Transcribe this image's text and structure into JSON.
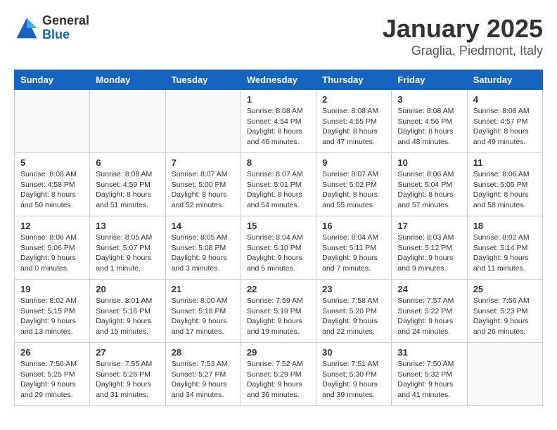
{
  "logo": {
    "general": "General",
    "blue": "Blue"
  },
  "title": "January 2025",
  "location": "Graglia, Piedmont, Italy",
  "weekdays": [
    "Sunday",
    "Monday",
    "Tuesday",
    "Wednesday",
    "Thursday",
    "Friday",
    "Saturday"
  ],
  "weeks": [
    [
      {
        "day": "",
        "info": ""
      },
      {
        "day": "",
        "info": ""
      },
      {
        "day": "",
        "info": ""
      },
      {
        "day": "1",
        "info": "Sunrise: 8:08 AM\nSunset: 4:54 PM\nDaylight: 8 hours and 46 minutes."
      },
      {
        "day": "2",
        "info": "Sunrise: 8:08 AM\nSunset: 4:55 PM\nDaylight: 8 hours and 47 minutes."
      },
      {
        "day": "3",
        "info": "Sunrise: 8:08 AM\nSunset: 4:56 PM\nDaylight: 8 hours and 48 minutes."
      },
      {
        "day": "4",
        "info": "Sunrise: 8:08 AM\nSunset: 4:57 PM\nDaylight: 8 hours and 49 minutes."
      }
    ],
    [
      {
        "day": "5",
        "info": "Sunrise: 8:08 AM\nSunset: 4:58 PM\nDaylight: 8 hours and 50 minutes."
      },
      {
        "day": "6",
        "info": "Sunrise: 8:08 AM\nSunset: 4:59 PM\nDaylight: 8 hours and 51 minutes."
      },
      {
        "day": "7",
        "info": "Sunrise: 8:07 AM\nSunset: 5:00 PM\nDaylight: 8 hours and 52 minutes."
      },
      {
        "day": "8",
        "info": "Sunrise: 8:07 AM\nSunset: 5:01 PM\nDaylight: 8 hours and 54 minutes."
      },
      {
        "day": "9",
        "info": "Sunrise: 8:07 AM\nSunset: 5:02 PM\nDaylight: 8 hours and 55 minutes."
      },
      {
        "day": "10",
        "info": "Sunrise: 8:06 AM\nSunset: 5:04 PM\nDaylight: 8 hours and 57 minutes."
      },
      {
        "day": "11",
        "info": "Sunrise: 8:06 AM\nSunset: 5:05 PM\nDaylight: 8 hours and 58 minutes."
      }
    ],
    [
      {
        "day": "12",
        "info": "Sunrise: 8:06 AM\nSunset: 5:06 PM\nDaylight: 9 hours and 0 minutes."
      },
      {
        "day": "13",
        "info": "Sunrise: 8:05 AM\nSunset: 5:07 PM\nDaylight: 9 hours and 1 minute."
      },
      {
        "day": "14",
        "info": "Sunrise: 8:05 AM\nSunset: 5:08 PM\nDaylight: 9 hours and 3 minutes."
      },
      {
        "day": "15",
        "info": "Sunrise: 8:04 AM\nSunset: 5:10 PM\nDaylight: 9 hours and 5 minutes."
      },
      {
        "day": "16",
        "info": "Sunrise: 8:04 AM\nSunset: 5:11 PM\nDaylight: 9 hours and 7 minutes."
      },
      {
        "day": "17",
        "info": "Sunrise: 8:03 AM\nSunset: 5:12 PM\nDaylight: 9 hours and 9 minutes."
      },
      {
        "day": "18",
        "info": "Sunrise: 8:02 AM\nSunset: 5:14 PM\nDaylight: 9 hours and 11 minutes."
      }
    ],
    [
      {
        "day": "19",
        "info": "Sunrise: 8:02 AM\nSunset: 5:15 PM\nDaylight: 9 hours and 13 minutes."
      },
      {
        "day": "20",
        "info": "Sunrise: 8:01 AM\nSunset: 5:16 PM\nDaylight: 9 hours and 15 minutes."
      },
      {
        "day": "21",
        "info": "Sunrise: 8:00 AM\nSunset: 5:18 PM\nDaylight: 9 hours and 17 minutes."
      },
      {
        "day": "22",
        "info": "Sunrise: 7:59 AM\nSunset: 5:19 PM\nDaylight: 9 hours and 19 minutes."
      },
      {
        "day": "23",
        "info": "Sunrise: 7:58 AM\nSunset: 5:20 PM\nDaylight: 9 hours and 22 minutes."
      },
      {
        "day": "24",
        "info": "Sunrise: 7:57 AM\nSunset: 5:22 PM\nDaylight: 9 hours and 24 minutes."
      },
      {
        "day": "25",
        "info": "Sunrise: 7:56 AM\nSunset: 5:23 PM\nDaylight: 9 hours and 26 minutes."
      }
    ],
    [
      {
        "day": "26",
        "info": "Sunrise: 7:56 AM\nSunset: 5:25 PM\nDaylight: 9 hours and 29 minutes."
      },
      {
        "day": "27",
        "info": "Sunrise: 7:55 AM\nSunset: 5:26 PM\nDaylight: 9 hours and 31 minutes."
      },
      {
        "day": "28",
        "info": "Sunrise: 7:53 AM\nSunset: 5:27 PM\nDaylight: 9 hours and 34 minutes."
      },
      {
        "day": "29",
        "info": "Sunrise: 7:52 AM\nSunset: 5:29 PM\nDaylight: 9 hours and 36 minutes."
      },
      {
        "day": "30",
        "info": "Sunrise: 7:51 AM\nSunset: 5:30 PM\nDaylight: 9 hours and 39 minutes."
      },
      {
        "day": "31",
        "info": "Sunrise: 7:50 AM\nSunset: 5:32 PM\nDaylight: 9 hours and 41 minutes."
      },
      {
        "day": "",
        "info": ""
      }
    ]
  ]
}
